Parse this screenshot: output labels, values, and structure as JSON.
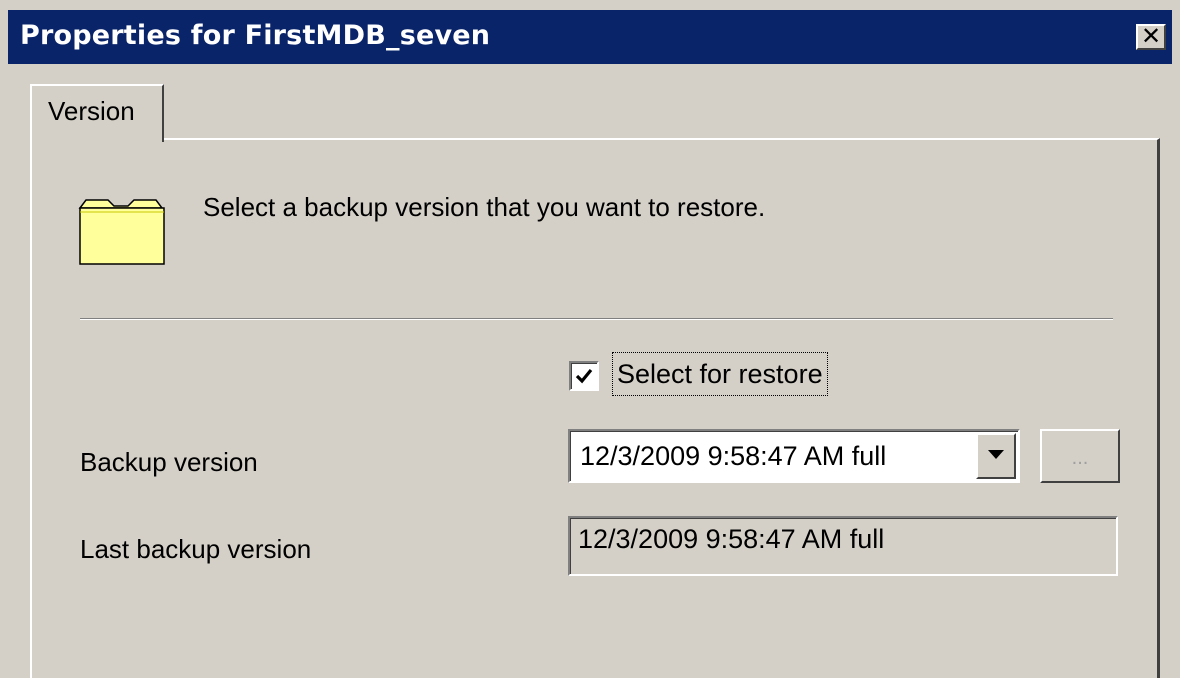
{
  "window": {
    "title": "Properties for FirstMDB_seven",
    "close_glyph": "✕"
  },
  "tabs": [
    {
      "label": "Version",
      "active": true
    }
  ],
  "version_tab": {
    "icon": "folder-icon",
    "intro_text": "Select a backup version that you want to restore.",
    "select_for_restore": {
      "label": "Select for restore",
      "checked": true
    },
    "backup_version": {
      "label": "Backup version",
      "selected_value": "12/3/2009 9:58:47 AM full",
      "browse_label": "..."
    },
    "last_backup_version": {
      "label": "Last backup version",
      "value": "12/3/2009 9:58:47 AM full"
    }
  },
  "colors": {
    "titlebar": "#0a246a",
    "face": "#d4d0c8",
    "folder_fill": "#ffff9c"
  }
}
